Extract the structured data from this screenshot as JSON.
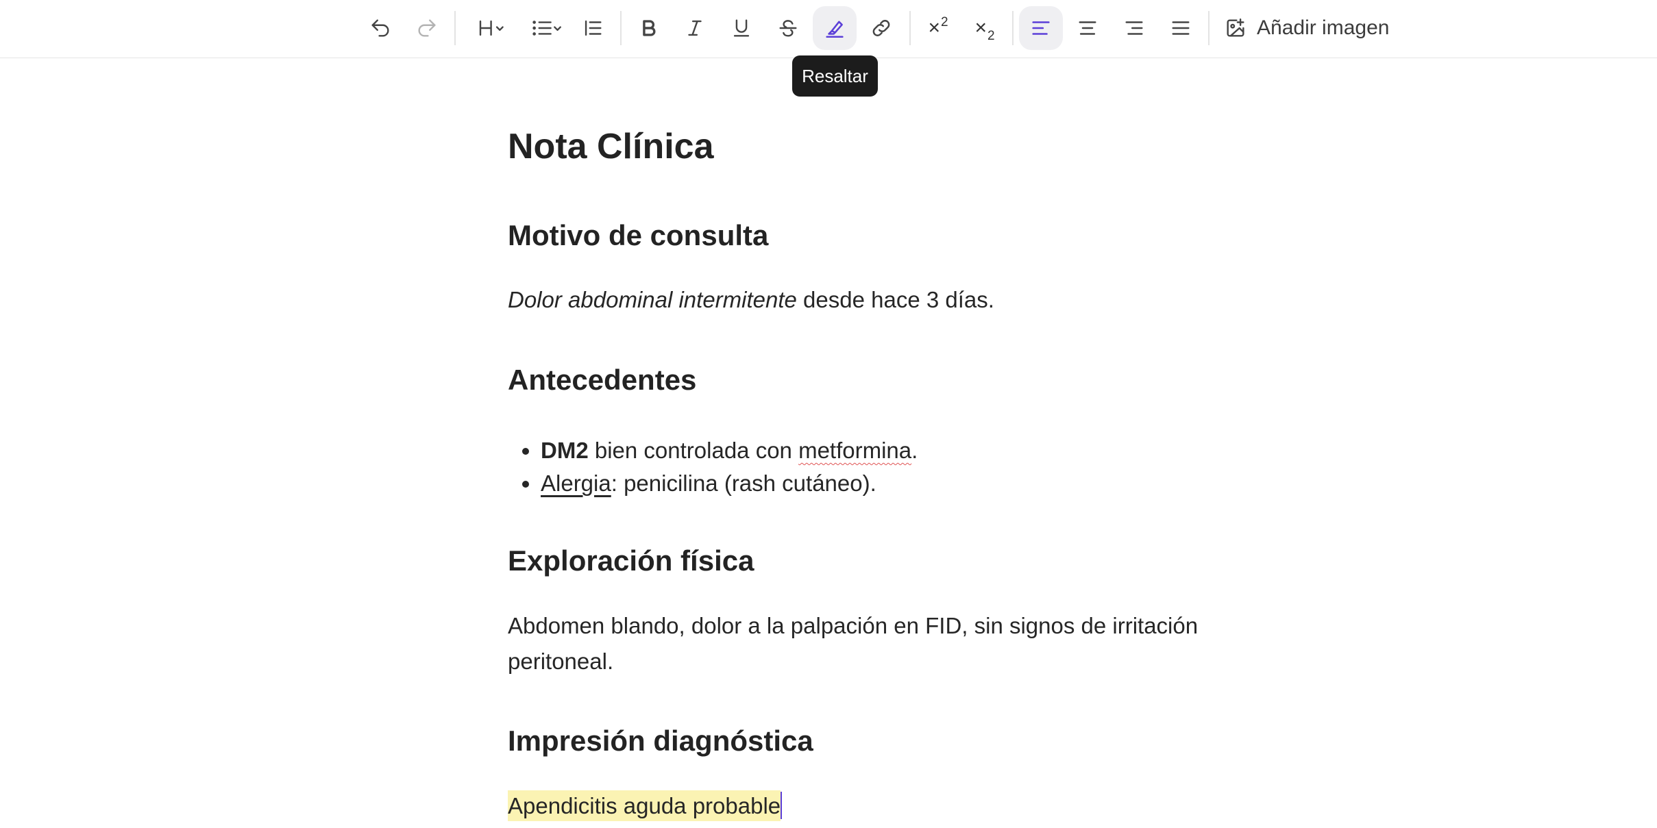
{
  "toolbar": {
    "items": [
      {
        "name": "undo-button",
        "icon": "undo-icon"
      },
      {
        "name": "redo-button",
        "icon": "redo-icon"
      },
      {
        "name": "heading-dropdown",
        "icon": "heading-icon"
      },
      {
        "name": "list-dropdown",
        "icon": "bulleted-list-icon"
      },
      {
        "name": "blockquote-button",
        "icon": "blockquote-icon"
      },
      {
        "name": "bold-button",
        "icon": "bold-icon"
      },
      {
        "name": "italic-button",
        "icon": "italic-icon"
      },
      {
        "name": "underline-button",
        "icon": "underline-icon"
      },
      {
        "name": "strikethrough-button",
        "icon": "strikethrough-icon"
      },
      {
        "name": "highlight-button",
        "icon": "highlighter-icon",
        "active": true
      },
      {
        "name": "link-button",
        "icon": "link-icon"
      },
      {
        "name": "superscript-button",
        "icon": "superscript-icon"
      },
      {
        "name": "subscript-button",
        "icon": "subscript-icon"
      },
      {
        "name": "align-left-button",
        "icon": "align-left-icon",
        "active": true
      },
      {
        "name": "align-center-button",
        "icon": "align-center-icon"
      },
      {
        "name": "align-right-button",
        "icon": "align-right-icon"
      },
      {
        "name": "align-justify-button",
        "icon": "align-justify-icon"
      }
    ],
    "add_image_label": "Añadir imagen",
    "add_image_icon": "image-plus-icon",
    "accent_color": "#5b3fd8"
  },
  "tooltip": {
    "text": "Resaltar"
  },
  "document": {
    "title": "Nota Clínica",
    "sections": {
      "reason": {
        "heading": "Motivo de consulta",
        "text_italic": "Dolor abdominal intermitente",
        "text_rest": " desde hace 3 días."
      },
      "history": {
        "heading": "Antecedentes",
        "item1_bold": "DM2",
        "item1_text": " bien controlada con ",
        "item1_misspelled": "metformina",
        "item1_end": ".",
        "item2_underlined": "Alergia",
        "item2_text": ": penicilina (rash cutáneo)."
      },
      "exam": {
        "heading": "Exploración física",
        "text": "Abdomen blando, dolor a la palpación en FID, sin signos de irritación peritoneal."
      },
      "impression": {
        "heading": "Impresión diagnóstica",
        "highlighted_text": "Apendicitis aguda probable",
        "highlight_color": "#fbf3b3"
      }
    }
  }
}
